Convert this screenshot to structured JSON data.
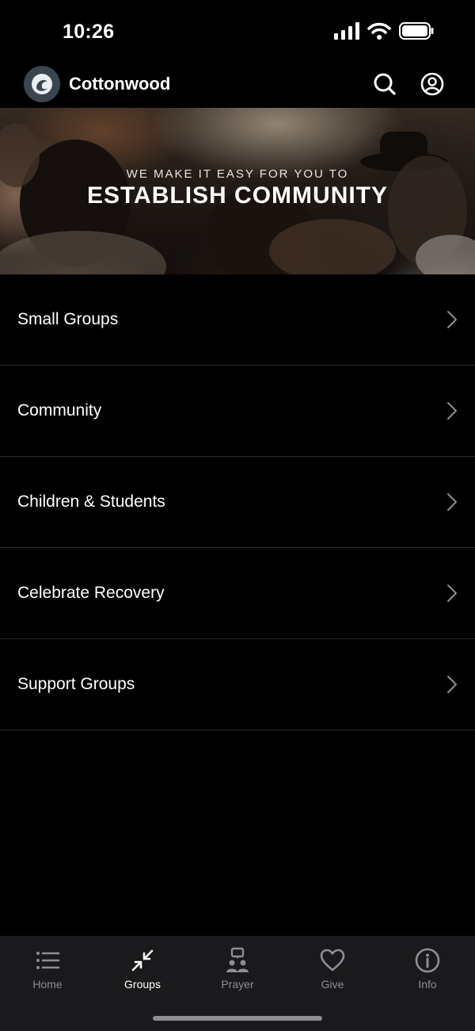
{
  "status_bar": {
    "time": "10:26"
  },
  "header": {
    "title": "Cottonwood",
    "logo_icon": "cottonwood-wave-logo",
    "search_icon": "search-icon",
    "account_icon": "account-icon"
  },
  "hero": {
    "kicker": "WE MAKE IT EASY FOR YOU TO",
    "heading": "ESTABLISH COMMUNITY"
  },
  "menu": {
    "items": [
      {
        "label": "Small Groups"
      },
      {
        "label": "Community"
      },
      {
        "label": "Children & Students"
      },
      {
        "label": "Celebrate Recovery"
      },
      {
        "label": "Support Groups"
      }
    ]
  },
  "tabs": [
    {
      "label": "Home",
      "icon": "list-icon",
      "active": false
    },
    {
      "label": "Groups",
      "icon": "arrows-collapse-icon",
      "active": true
    },
    {
      "label": "Prayer",
      "icon": "prayer-icon",
      "active": false
    },
    {
      "label": "Give",
      "icon": "heart-icon",
      "active": false
    },
    {
      "label": "Info",
      "icon": "info-icon",
      "active": false
    }
  ],
  "colors": {
    "background": "#000000",
    "tab_bar": "#1a1a1c",
    "inactive": "#8e8e93",
    "active": "#ffffff",
    "divider": "#2c2c2e"
  }
}
